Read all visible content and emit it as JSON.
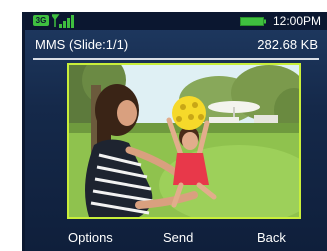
{
  "status": {
    "network": "3G",
    "time": "12:00PM",
    "signal_icon": "signal-bars-icon",
    "battery_icon": "battery-full-icon",
    "accent": "#3fbf3f"
  },
  "header": {
    "title": "MMS (Slide:1/1)",
    "size": "282.68 KB"
  },
  "photo": {
    "subject": "mother-and-daughter-playing-with-ball-photo",
    "frame_color": "#c9ef3a"
  },
  "softkeys": {
    "left": "Options",
    "center": "Send",
    "right": "Back"
  }
}
